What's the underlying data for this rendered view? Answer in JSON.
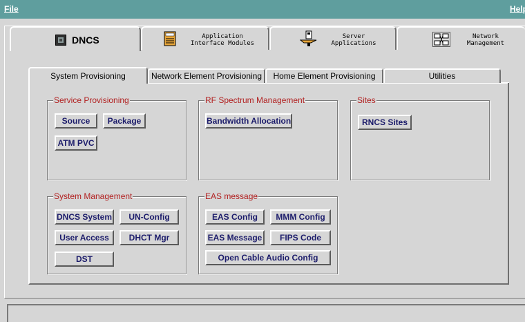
{
  "menubar": {
    "file": "File",
    "help": "Help"
  },
  "top_tabs": [
    {
      "label": "DNCS",
      "icon": "dncs-icon"
    },
    {
      "label": "Application\nInterface Modules",
      "icon": "document-icon"
    },
    {
      "label": "Server\nApplications",
      "icon": "server-icon"
    },
    {
      "label": "Network\nManagement",
      "icon": "network-icon"
    }
  ],
  "sub_tabs": [
    "System Provisioning",
    "Network Element Provisioning",
    "Home Element Provisioning",
    "Utilities"
  ],
  "groups": {
    "service": {
      "title": "Service Provisioning",
      "buttons": [
        "Source",
        "Package",
        "ATM PVC"
      ]
    },
    "rf": {
      "title": "RF Spectrum Management",
      "buttons": [
        "Bandwidth Allocation"
      ]
    },
    "sites": {
      "title": "Sites",
      "buttons": [
        "RNCS Sites"
      ]
    },
    "system": {
      "title": "System Management",
      "buttons": [
        "DNCS System",
        "UN-Config",
        "User Access",
        "DHCT Mgr",
        "DST"
      ]
    },
    "eas": {
      "title": "EAS message",
      "buttons": [
        "EAS Config",
        "MMM Config",
        "EAS Message",
        "FIPS Code",
        "Open Cable Audio Config"
      ]
    }
  },
  "colors": {
    "menubar": "#5f9e9e",
    "group_title": "#b22222",
    "button_text": "#1c1c6b"
  }
}
